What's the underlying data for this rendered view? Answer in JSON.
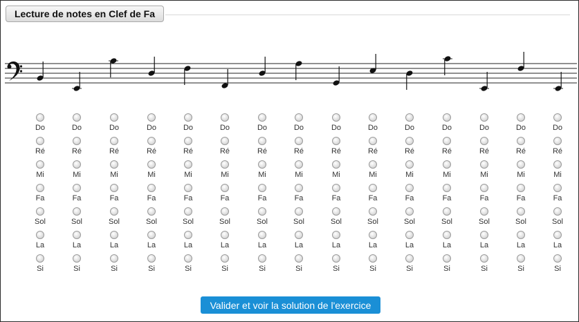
{
  "header": {
    "title": "Lecture de notes en Clef de Fa"
  },
  "exercise": {
    "clef": "bass-clef-icon",
    "questions": [
      {
        "answer_options": [
          "Do",
          "Ré",
          "Mi",
          "Fa",
          "Sol",
          "La",
          "Si"
        ]
      },
      {
        "answer_options": [
          "Do",
          "Ré",
          "Mi",
          "Fa",
          "Sol",
          "La",
          "Si"
        ]
      },
      {
        "answer_options": [
          "Do",
          "Ré",
          "Mi",
          "Fa",
          "Sol",
          "La",
          "Si"
        ]
      },
      {
        "answer_options": [
          "Do",
          "Ré",
          "Mi",
          "Fa",
          "Sol",
          "La",
          "Si"
        ]
      },
      {
        "answer_options": [
          "Do",
          "Ré",
          "Mi",
          "Fa",
          "Sol",
          "La",
          "Si"
        ]
      },
      {
        "answer_options": [
          "Do",
          "Ré",
          "Mi",
          "Fa",
          "Sol",
          "La",
          "Si"
        ]
      },
      {
        "answer_options": [
          "Do",
          "Ré",
          "Mi",
          "Fa",
          "Sol",
          "La",
          "Si"
        ]
      },
      {
        "answer_options": [
          "Do",
          "Ré",
          "Mi",
          "Fa",
          "Sol",
          "La",
          "Si"
        ]
      },
      {
        "answer_options": [
          "Do",
          "Ré",
          "Mi",
          "Fa",
          "Sol",
          "La",
          "Si"
        ]
      },
      {
        "answer_options": [
          "Do",
          "Ré",
          "Mi",
          "Fa",
          "Sol",
          "La",
          "Si"
        ]
      },
      {
        "answer_options": [
          "Do",
          "Ré",
          "Mi",
          "Fa",
          "Sol",
          "La",
          "Si"
        ]
      },
      {
        "answer_options": [
          "Do",
          "Ré",
          "Mi",
          "Fa",
          "Sol",
          "La",
          "Si"
        ]
      },
      {
        "answer_options": [
          "Do",
          "Ré",
          "Mi",
          "Fa",
          "Sol",
          "La",
          "Si"
        ]
      },
      {
        "answer_options": [
          "Do",
          "Ré",
          "Mi",
          "Fa",
          "Sol",
          "La",
          "Si"
        ]
      },
      {
        "answer_options": [
          "Do",
          "Ré",
          "Mi",
          "Fa",
          "Sol",
          "La",
          "Si"
        ]
      }
    ]
  },
  "actions": {
    "submit_label": "Valider et voir la solution de l'exercice"
  }
}
